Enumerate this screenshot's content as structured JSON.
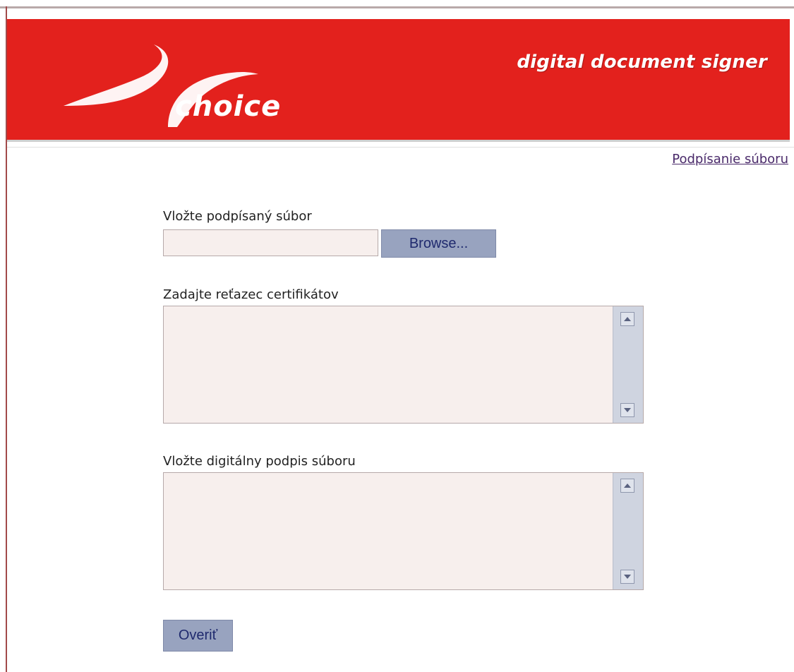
{
  "header": {
    "tagline": "digital document signer",
    "logo_text": "choice"
  },
  "nav": {
    "sign_file_link": "Podpísanie súboru"
  },
  "form": {
    "file_label": "Vložte podpísaný súbor",
    "file_value": "",
    "browse_label": "Browse...",
    "cert_label": "Zadajte reťazec certifikátov",
    "cert_value": "",
    "signature_label": "Vložte digitálny podpis súboru",
    "signature_value": "",
    "verify_label": "Overiť"
  },
  "colors": {
    "header_red": "#e3211d",
    "button_fill": "#98a3bf",
    "input_fill": "#f7efed"
  },
  "icons": [
    "logo-swoosh-icon",
    "scroll-up-arrow-icon",
    "scroll-down-arrow-icon"
  ]
}
